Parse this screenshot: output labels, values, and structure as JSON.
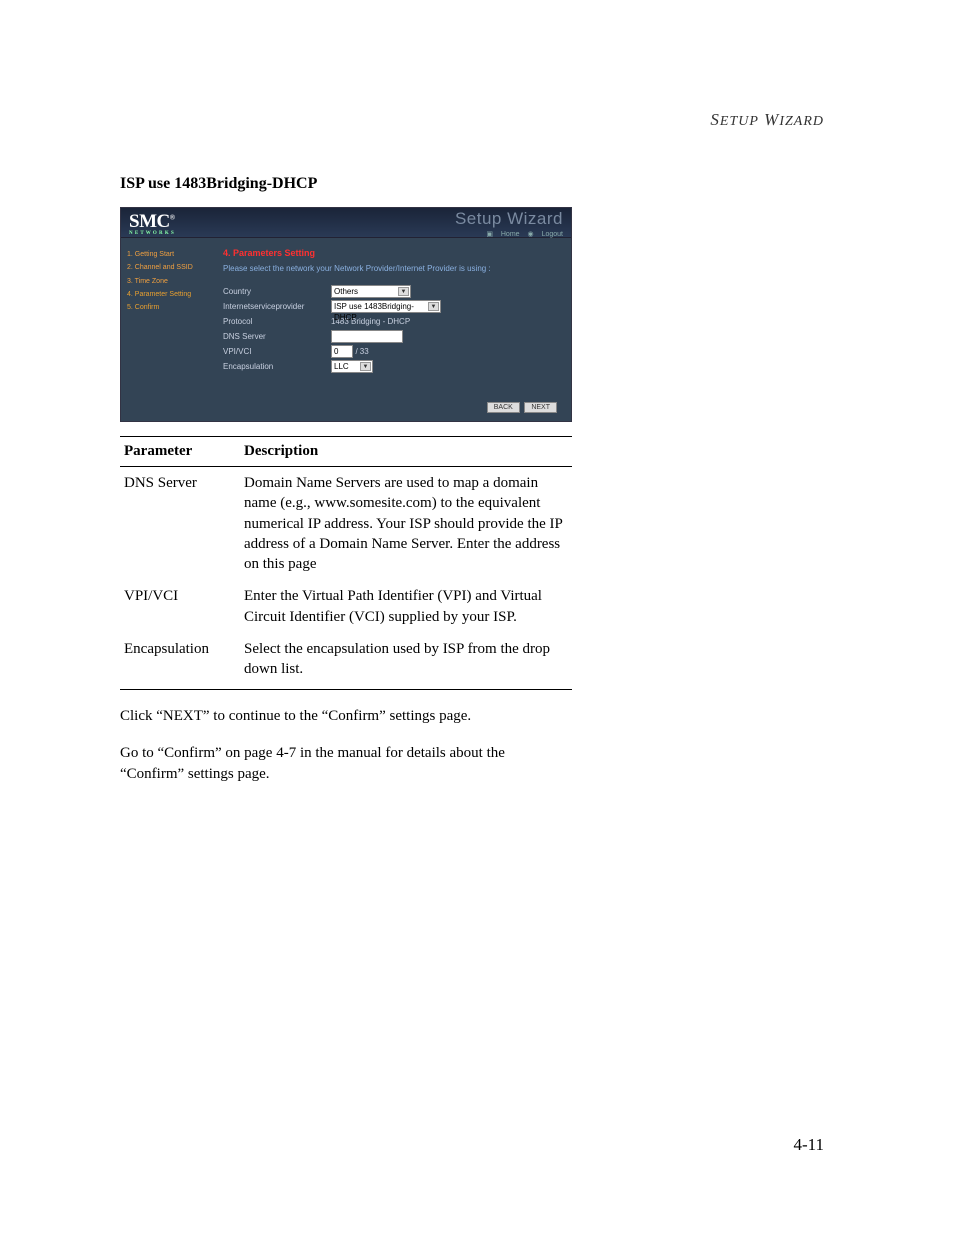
{
  "running_header": "Setup Wizard",
  "section_title": "ISP use 1483Bridging-DHCP",
  "screenshot": {
    "logo_main": "SMC",
    "logo_sub": "N E T W O R K S",
    "header_title": "Setup Wizard",
    "header_links": {
      "home": "Home",
      "logout": "Logout"
    },
    "sidebar": {
      "items": [
        {
          "label": "1. Getting Start"
        },
        {
          "label": "2. Channel and SSID"
        },
        {
          "label": "3. Time Zone"
        },
        {
          "label": "4. Parameter Setting"
        },
        {
          "label": "5. Confirm"
        }
      ]
    },
    "main": {
      "title": "4. Parameters Setting",
      "instruction": "Please select the network your Network Provider/Internet Provider is using :",
      "rows": {
        "country": {
          "label": "Country",
          "value": "Others"
        },
        "isp": {
          "label": "Internetserviceprovider",
          "value": "ISP use 1483Bridging-DHCP"
        },
        "protocol": {
          "label": "Protocol",
          "value": "1483 Bridging - DHCP"
        },
        "dns": {
          "label": "DNS Server",
          "value": ""
        },
        "vpivci": {
          "label": "VPI/VCI",
          "vpi": "0",
          "sep": "/",
          "vci": "33"
        },
        "encap": {
          "label": "Encapsulation",
          "value": "LLC"
        }
      },
      "buttons": {
        "back": "BACK",
        "next": "NEXT"
      }
    }
  },
  "table": {
    "headers": {
      "param": "Parameter",
      "desc": "Description"
    },
    "rows": [
      {
        "param": "DNS Server",
        "desc": "Domain Name Servers are used to map a domain name (e.g., www.somesite.com) to the equivalent numerical IP address. Your ISP should provide the IP address of a Domain Name Server. Enter the address on this page"
      },
      {
        "param": "VPI/VCI",
        "desc": "Enter the Virtual Path Identifier (VPI) and Virtual Circuit Identifier (VCI) supplied by your ISP."
      },
      {
        "param": "Encapsulation",
        "desc": "Select the encapsulation used by ISP from the drop down list."
      }
    ]
  },
  "body_text_1": "Click “NEXT” to continue to the “Confirm” settings page.",
  "body_text_2": "Go to “Confirm” on page 4-7 in the manual for details about the “Confirm” settings page.",
  "page_number": "4-11"
}
